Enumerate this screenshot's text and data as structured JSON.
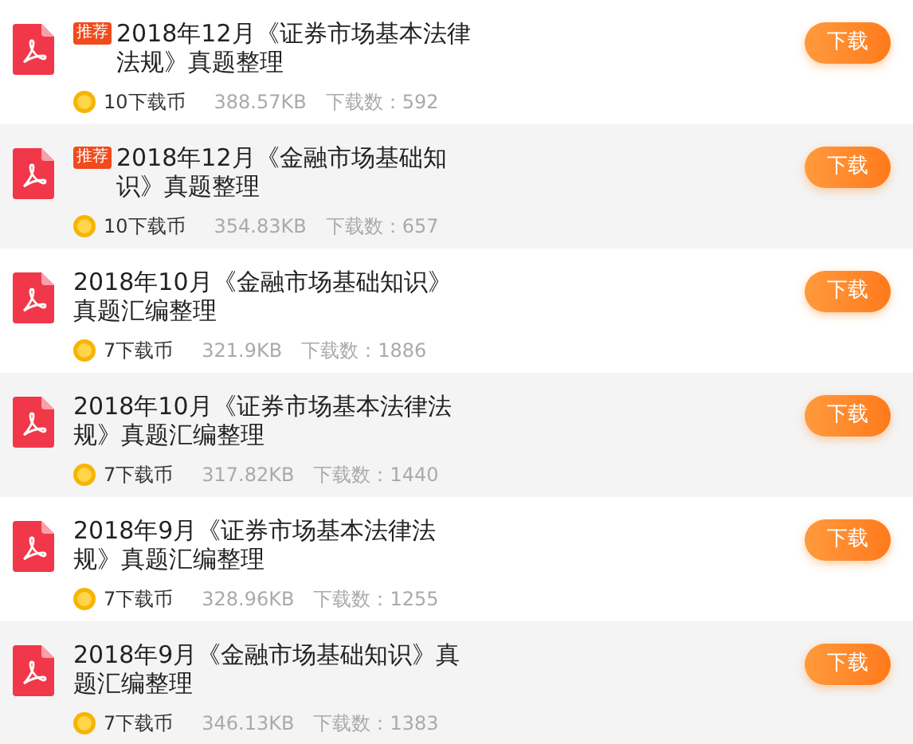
{
  "files": [
    {
      "badge": "推荐",
      "title": "2018年12月《证券市场基本法律法规》真题整理",
      "price": "10下载币",
      "size": "388.57KB",
      "downloads": "下载数：592",
      "button": "下载"
    },
    {
      "badge": "推荐",
      "title": "2018年12月《金融市场基础知识》真题整理",
      "price": "10下载币",
      "size": "354.83KB",
      "downloads": "下载数：657",
      "button": "下载"
    },
    {
      "title": "2018年10月《金融市场基础知识》真题汇编整理",
      "price": "7下载币",
      "size": "321.9KB",
      "downloads": "下载数：1886",
      "button": "下载"
    },
    {
      "title": "2018年10月《证券市场基本法律法规》真题汇编整理",
      "price": "7下载币",
      "size": "317.82KB",
      "downloads": "下载数：1440",
      "button": "下载"
    },
    {
      "title": "2018年9月《证券市场基本法律法规》真题汇编整理",
      "price": "7下载币",
      "size": "328.96KB",
      "downloads": "下载数：1255",
      "button": "下载"
    },
    {
      "title": "2018年9月《金融市场基础知识》真题汇编整理",
      "price": "7下载币",
      "size": "346.13KB",
      "downloads": "下载数：1383",
      "button": "下载"
    }
  ]
}
